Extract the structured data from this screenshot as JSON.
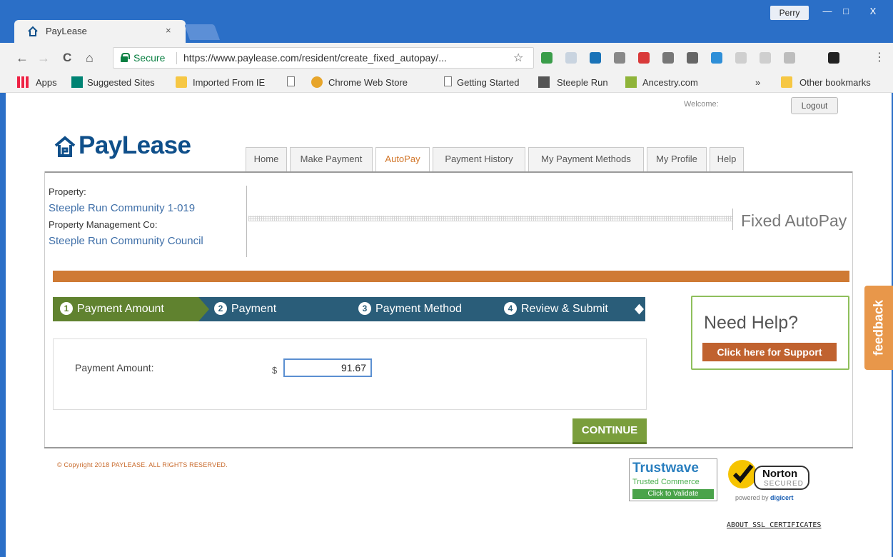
{
  "window": {
    "profile": "Perry",
    "min_label": "—",
    "max_label": "□",
    "close_label": "X"
  },
  "tab": {
    "title": "PayLease",
    "close": "×"
  },
  "toolbar": {
    "back": "←",
    "forward": "→",
    "reload": "C",
    "home": "⌂",
    "secure_label": "Secure",
    "url": "https://www.paylease.com/resident/create_fixed_autopay/...",
    "star": "☆",
    "menu": "⋮"
  },
  "bookmarks": {
    "apps": "Apps",
    "items": [
      "Suggested Sites",
      "Imported From IE",
      "Chrome Web Store",
      "Getting Started",
      "Steeple Run",
      "Ancestry.com"
    ],
    "overflow": "»",
    "other": "Other bookmarks"
  },
  "header": {
    "welcome": "Welcome:",
    "logout": "Logout",
    "logo_text": "PayLease"
  },
  "nav": {
    "tabs": [
      "Home",
      "Make Payment",
      "AutoPay",
      "Payment History",
      "My Payment Methods",
      "My Profile",
      "Help"
    ],
    "active_index": 2
  },
  "property": {
    "property_label": "Property:",
    "property_value": "Steeple Run Community 1-019",
    "mgmt_label": "Property Management Co:",
    "mgmt_value": "Steeple Run Community Council"
  },
  "section_title": "Fixed AutoPay",
  "steps": [
    {
      "num": "1",
      "label": "Payment Amount"
    },
    {
      "num": "2",
      "label": "Payment"
    },
    {
      "num": "3",
      "label": "Payment Method"
    },
    {
      "num": "4",
      "label": "Review & Submit"
    }
  ],
  "help": {
    "title": "Need Help?",
    "button": "Click here for Support"
  },
  "amount": {
    "label": "Payment Amount:",
    "currency": "$",
    "value": "91.67"
  },
  "continue_label": "CONTINUE",
  "footer": {
    "copyright": "© Copyright 2018 PAYLEASE. ALL RIGHTS RESERVED.",
    "trustwave": {
      "name": "Trustwave",
      "sub": "Trusted Commerce",
      "validate": "Click to Validate"
    },
    "norton": {
      "name": "Norton",
      "secured": "SECURED",
      "powered": "powered by",
      "digicert": "digicert"
    },
    "ssl_link": "ABOUT SSL CERTIFICATES"
  },
  "feedback": "feedback",
  "colors": {
    "brand_blue": "#0f4f8a",
    "accent_orange": "#cf7a34",
    "step_active": "#60822f",
    "step_inactive": "#2a5d79",
    "continue_green": "#7a9e3c",
    "support_button": "#c0622f"
  }
}
